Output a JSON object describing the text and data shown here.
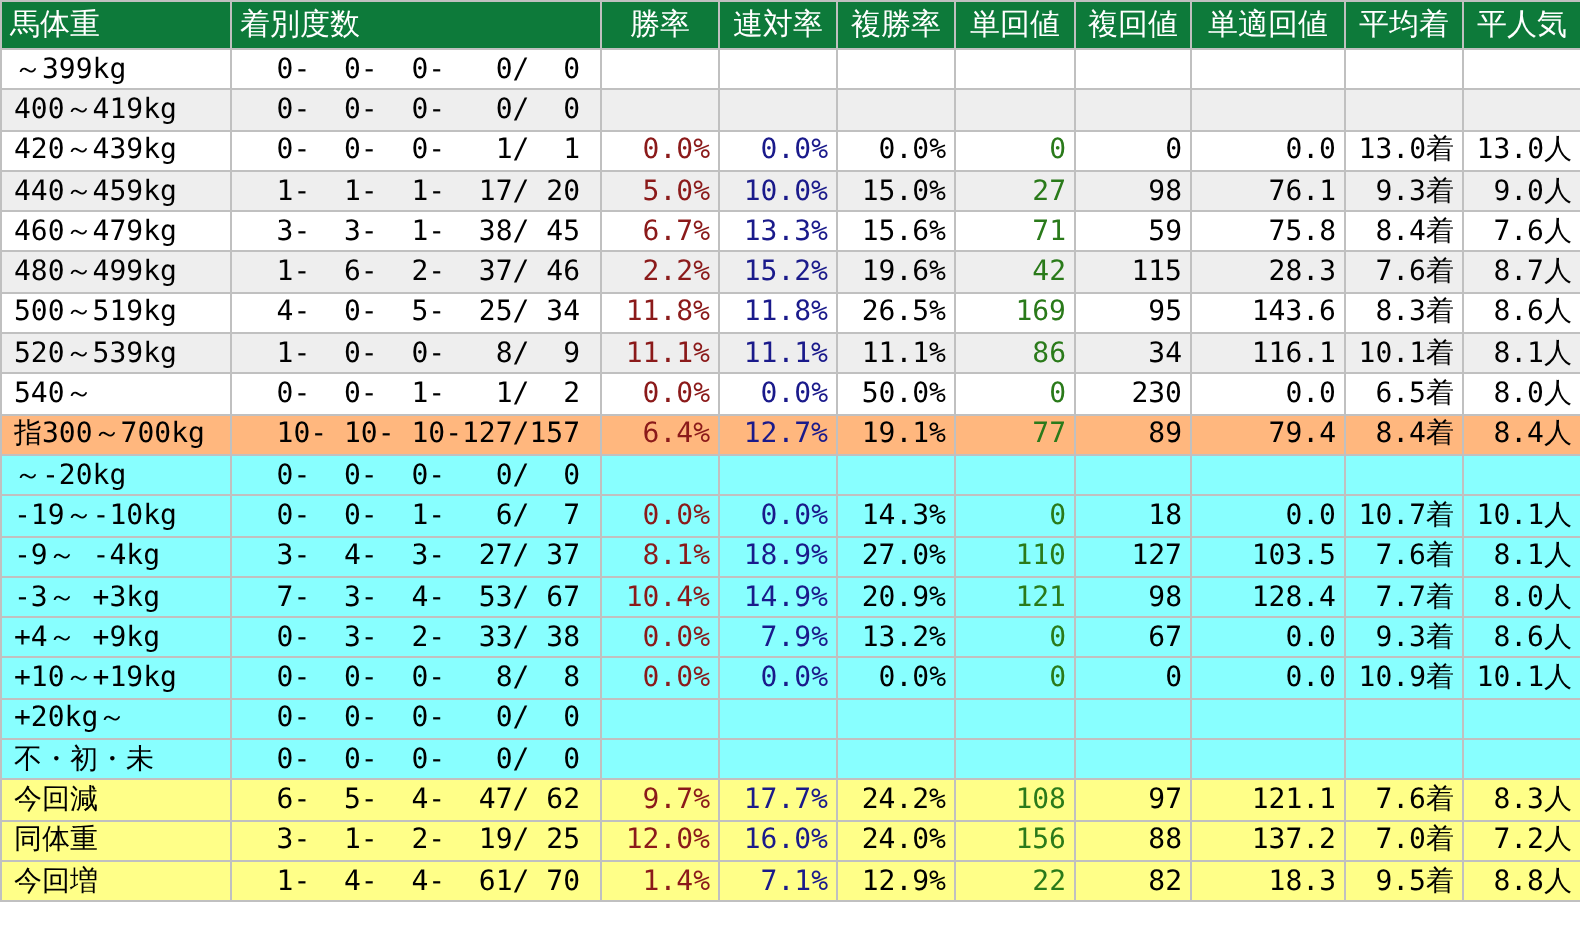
{
  "table": {
    "columns": [
      "馬体重",
      "着別度数",
      "勝率",
      "連対率",
      "複勝率",
      "単回値",
      "複回値",
      "単適回値",
      "平均着",
      "平人気"
    ],
    "rows": [
      {
        "kind": "weight",
        "label": "～399kg",
        "record": "0-  0-  0-   0/  0"
      },
      {
        "kind": "weight",
        "label": "400～419kg",
        "record": "0-  0-  0-   0/  0"
      },
      {
        "kind": "weight",
        "label": "420～439kg",
        "record": "0-  0-  0-   1/  1",
        "stats": [
          "0.0%",
          "0.0%",
          "0.0%",
          "0",
          "0",
          "0.0",
          "13.0着",
          "13.0人"
        ]
      },
      {
        "kind": "weight",
        "label": "440～459kg",
        "record": "1-  1-  1-  17/ 20",
        "stats": [
          "5.0%",
          "10.0%",
          "15.0%",
          "27",
          "98",
          "76.1",
          "9.3着",
          "9.0人"
        ]
      },
      {
        "kind": "weight",
        "label": "460～479kg",
        "record": "3-  3-  1-  38/ 45",
        "stats": [
          "6.7%",
          "13.3%",
          "15.6%",
          "71",
          "59",
          "75.8",
          "8.4着",
          "7.6人"
        ]
      },
      {
        "kind": "weight",
        "label": "480～499kg",
        "record": "1-  6-  2-  37/ 46",
        "stats": [
          "2.2%",
          "15.2%",
          "19.6%",
          "42",
          "115",
          "28.3",
          "7.6着",
          "8.7人"
        ]
      },
      {
        "kind": "weight",
        "label": "500～519kg",
        "record": "4-  0-  5-  25/ 34",
        "stats": [
          "11.8%",
          "11.8%",
          "26.5%",
          "169",
          "95",
          "143.6",
          "8.3着",
          "8.6人"
        ]
      },
      {
        "kind": "weight",
        "label": "520～539kg",
        "record": "1-  0-  0-   8/  9",
        "stats": [
          "11.1%",
          "11.1%",
          "11.1%",
          "86",
          "34",
          "116.1",
          "10.1着",
          "8.1人"
        ]
      },
      {
        "kind": "weight",
        "label": "540～",
        "record": "0-  0-  1-   1/  2",
        "stats": [
          "0.0%",
          "0.0%",
          "50.0%",
          "0",
          "230",
          "0.0",
          "6.5着",
          "8.0人"
        ]
      },
      {
        "kind": "total",
        "label": "指300～700kg",
        "record": "10- 10- 10-127/157",
        "stats": [
          "6.4%",
          "12.7%",
          "19.1%",
          "77",
          "89",
          "79.4",
          "8.4着",
          "8.4人"
        ]
      },
      {
        "kind": "change",
        "label": "～-20kg",
        "record": "0-  0-  0-   0/  0"
      },
      {
        "kind": "change",
        "label": "-19～-10kg",
        "record": "0-  0-  1-   6/  7",
        "stats": [
          "0.0%",
          "0.0%",
          "14.3%",
          "0",
          "18",
          "0.0",
          "10.7着",
          "10.1人"
        ]
      },
      {
        "kind": "change",
        "label": "-9～ -4kg",
        "record": "3-  4-  3-  27/ 37",
        "stats": [
          "8.1%",
          "18.9%",
          "27.0%",
          "110",
          "127",
          "103.5",
          "7.6着",
          "8.1人"
        ]
      },
      {
        "kind": "change",
        "label": "-3～ +3kg",
        "record": "7-  3-  4-  53/ 67",
        "stats": [
          "10.4%",
          "14.9%",
          "20.9%",
          "121",
          "98",
          "128.4",
          "7.7着",
          "8.0人"
        ]
      },
      {
        "kind": "change",
        "label": "+4～ +9kg",
        "record": "0-  3-  2-  33/ 38",
        "stats": [
          "0.0%",
          "7.9%",
          "13.2%",
          "0",
          "67",
          "0.0",
          "9.3着",
          "8.6人"
        ]
      },
      {
        "kind": "change",
        "label": "+10～+19kg",
        "record": "0-  0-  0-   8/  8",
        "stats": [
          "0.0%",
          "0.0%",
          "0.0%",
          "0",
          "0",
          "0.0",
          "10.9着",
          "10.1人"
        ]
      },
      {
        "kind": "change",
        "label": "+20kg～",
        "record": "0-  0-  0-   0/  0"
      },
      {
        "kind": "change",
        "label": "不・初・未",
        "record": "0-  0-  0-   0/  0"
      },
      {
        "kind": "trend",
        "label": "今回減",
        "record": "6-  5-  4-  47/ 62",
        "stats": [
          "9.7%",
          "17.7%",
          "24.2%",
          "108",
          "97",
          "121.1",
          "7.6着",
          "8.3人"
        ]
      },
      {
        "kind": "trend",
        "label": "同体重",
        "record": "3-  1-  2-  19/ 25",
        "stats": [
          "12.0%",
          "16.0%",
          "24.0%",
          "156",
          "88",
          "137.2",
          "7.0着",
          "7.2人"
        ]
      },
      {
        "kind": "trend",
        "label": "今回増",
        "record": "1-  4-  4-  61/ 70",
        "stats": [
          "1.4%",
          "7.1%",
          "12.9%",
          "22",
          "82",
          "18.3",
          "9.5着",
          "8.8人"
        ]
      }
    ]
  }
}
